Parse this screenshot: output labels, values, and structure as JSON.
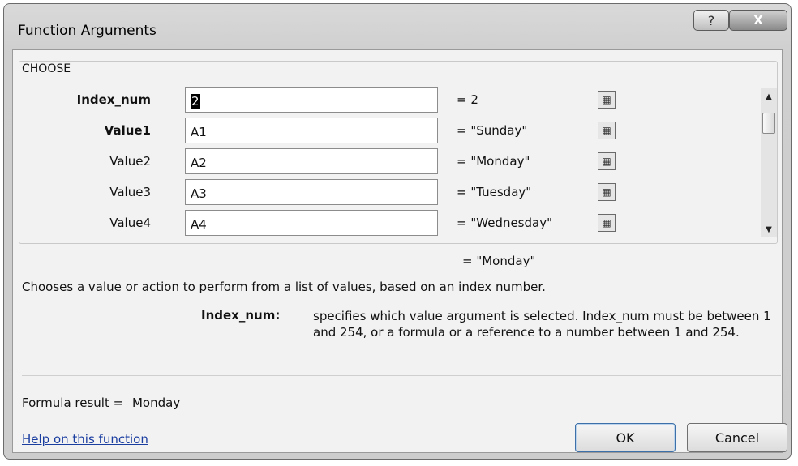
{
  "dialog": {
    "title": "Function Arguments",
    "help_glyph": "?",
    "close_glyph": "X"
  },
  "function": {
    "name": "CHOOSE",
    "arguments": [
      {
        "label": "Index_num",
        "bold": true,
        "value": "2",
        "evaluated": "= 2",
        "focused": true
      },
      {
        "label": "Value1",
        "bold": true,
        "value": "A1",
        "evaluated": "= \"Sunday\""
      },
      {
        "label": "Value2",
        "bold": false,
        "value": "A2",
        "evaluated": "= \"Monday\""
      },
      {
        "label": "Value3",
        "bold": false,
        "value": "A3",
        "evaluated": "= \"Tuesday\""
      },
      {
        "label": "Value4",
        "bold": false,
        "value": "A4",
        "evaluated": "= \"Wednesday\""
      }
    ],
    "result_evaluated": "= \"Monday\"",
    "description": "Chooses a value or action to perform from a list of values, based on an index number.",
    "param_name": "Index_num:",
    "param_description": "specifies which value argument is selected. Index_num must be between 1 and 254, or a formula or a reference to a number between 1 and 254."
  },
  "footer": {
    "formula_result_label": "Formula result =",
    "formula_result_value": "Monday",
    "help_link": "Help on this function",
    "ok_label": "OK",
    "cancel_label": "Cancel"
  },
  "icons": {
    "ref_button": "range-selector-icon",
    "scroll_up": "arrow-up-icon",
    "scroll_down": "arrow-down-icon"
  }
}
